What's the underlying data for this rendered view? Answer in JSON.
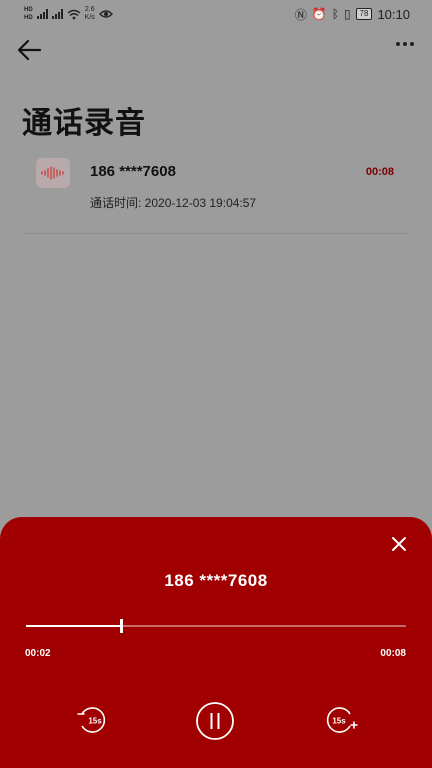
{
  "status_bar": {
    "net_speed_value": "2.6",
    "net_speed_unit": "K/s",
    "battery": "78",
    "time": "10:10"
  },
  "page": {
    "title": "通话录音"
  },
  "recording": {
    "number": "186 ****7608",
    "duration": "00:08",
    "call_time": "通话时间: 2020-12-03 19:04:57"
  },
  "player": {
    "number": "186 ****7608",
    "current_time": "00:02",
    "total_time": "00:08",
    "progress": 0.25,
    "rewind_label": "15s",
    "forward_label": "15s"
  },
  "colors": {
    "player_bg": "#a00000",
    "overlay": "#9c9c9c",
    "accent": "#7a0000"
  }
}
